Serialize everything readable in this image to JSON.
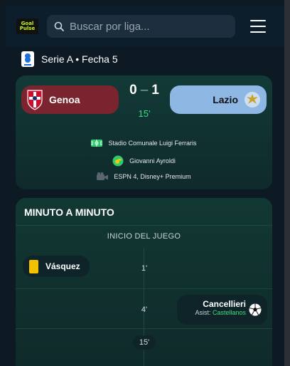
{
  "header": {
    "logo_line1": "Goal",
    "logo_line2": "Pulse",
    "search_placeholder": "Buscar por liga..."
  },
  "league": {
    "title": "Serie A • Fecha 5"
  },
  "match": {
    "home_team": "Genoa",
    "away_team": "Lazio",
    "home_score": "0",
    "away_score": "1",
    "minute": "15'",
    "stadium": "Stadio Comunale Luigi Ferraris",
    "referee": "Giovanni Ayroldi",
    "broadcast": "ESPN 4, Disney+ Premium"
  },
  "timeline": {
    "title": "MINUTO A MINUTO",
    "kickoff_label": "INICIO DEL JUEGO",
    "events": [
      {
        "minute": "1'",
        "player": "Vásquez",
        "icon": "yellow-card-icon"
      },
      {
        "minute": "4'",
        "player": "Cancellieri",
        "assist_label": "Asist:",
        "assist": "Castellanos",
        "icon": "soccer-ball-icon"
      }
    ],
    "current_minute": "15'"
  },
  "colors": {
    "home_team": "#7a2430",
    "away_team": "#8fb7e3",
    "accent_green": "#3ddc84",
    "yellow_card": "#f2c200"
  }
}
